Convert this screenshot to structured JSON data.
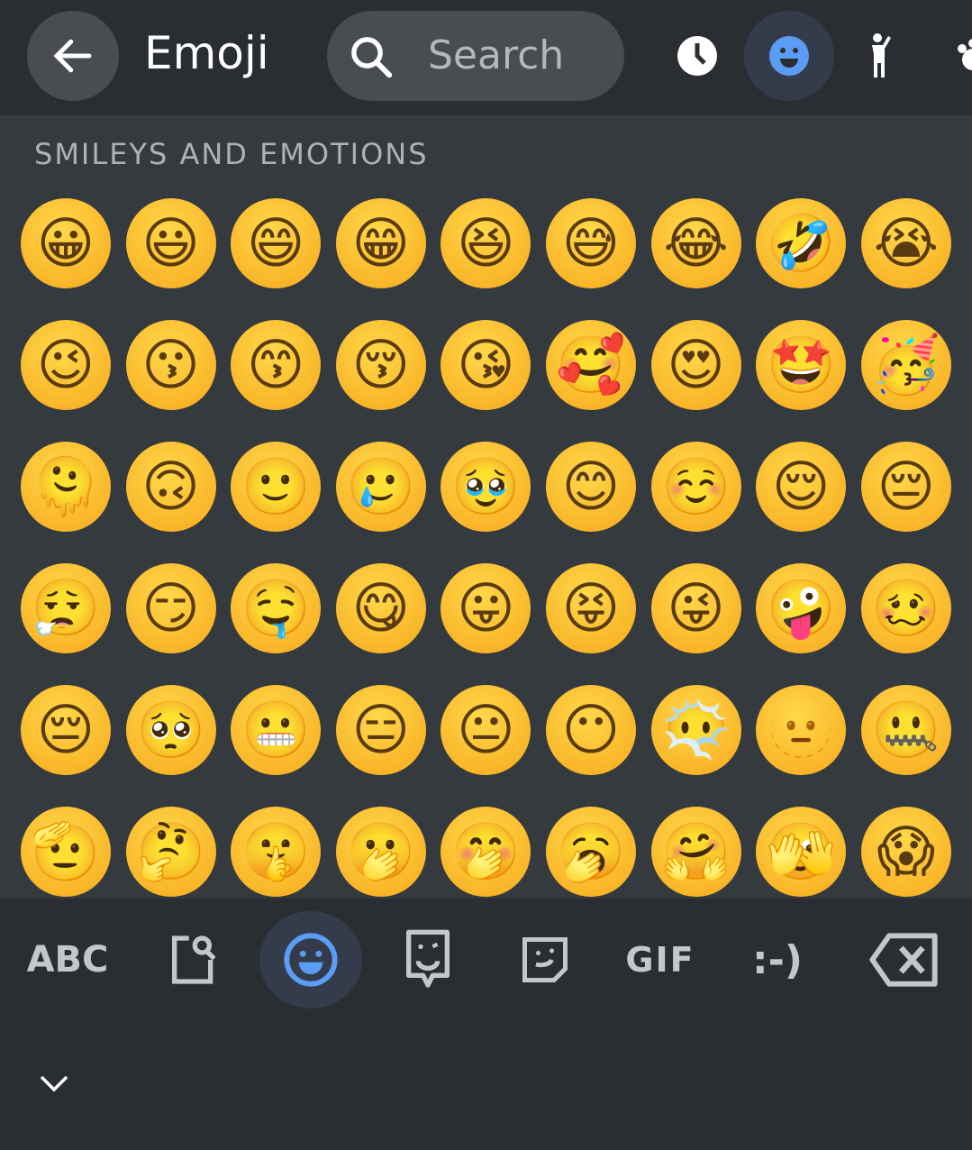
{
  "header": {
    "title": "Emoji",
    "search_placeholder": "Search"
  },
  "categories": [
    {
      "name": "recent",
      "icon": "clock-icon",
      "active": false
    },
    {
      "name": "smileys",
      "icon": "smiley-icon",
      "active": true
    },
    {
      "name": "people",
      "icon": "person-icon",
      "active": false
    },
    {
      "name": "animals",
      "icon": "paw-icon",
      "active": false
    }
  ],
  "section_title": "SMILEYS AND EMOTIONS",
  "emoji_rows": [
    [
      "😀",
      "😃",
      "😄",
      "😁",
      "😆",
      "😅",
      "😂",
      "🤣",
      "😭"
    ],
    [
      "😉",
      "😗",
      "😙",
      "😚",
      "😘",
      "🥰",
      "😍",
      "🤩",
      "🥳"
    ],
    [
      "🫠",
      "🙃",
      "🙂",
      "🥲",
      "🥹",
      "😊",
      "☺️",
      "😌",
      "😔"
    ],
    [
      "😮‍💨",
      "😏",
      "🤤",
      "😋",
      "😛",
      "😝",
      "😜",
      "🤪",
      "🥴"
    ],
    [
      "😔",
      "🥺",
      "😬",
      "😑",
      "😐",
      "😶",
      "😶‍🌫️",
      "🫥",
      "🤐"
    ],
    [
      "🫡",
      "🤔",
      "🤫",
      "🫢",
      "🤭",
      "🥱",
      "🤗",
      "🫣",
      "😱"
    ]
  ],
  "bottom_bar": {
    "abc": "ABC",
    "gif": "GIF",
    "emoticon": ":-)"
  },
  "colors": {
    "accent": "#5b9cf5",
    "bg": "#2a2e33",
    "panel": "#353a3f"
  }
}
